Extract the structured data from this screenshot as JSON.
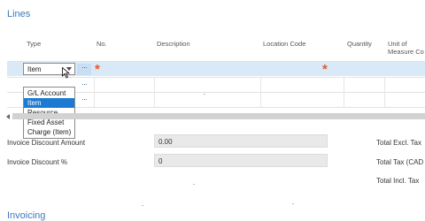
{
  "lines": {
    "heading": "Lines",
    "columns": {
      "type": "Type",
      "no": "No.",
      "description": "Description",
      "location_code": "Location Code",
      "quantity": "Quantity",
      "unit_of_measure": [
        "Unit of",
        "Measure Co"
      ]
    },
    "current_row": {
      "type_value": "Item",
      "lookup_label": "···",
      "required_marker": "*"
    },
    "type_dropdown": {
      "options": [
        "G/L Account",
        "Item",
        "Resource",
        "Fixed Asset",
        "Charge (Item)"
      ],
      "selected": "Item"
    }
  },
  "totals": {
    "invoice_discount_amount_label": "Invoice Discount Amount",
    "invoice_discount_amount_value": "0.00",
    "invoice_discount_pct_label": "Invoice Discount %",
    "invoice_discount_pct_value": "0",
    "total_excl_tax_label": "Total Excl. Tax",
    "total_tax_label": "Total Tax (CAD",
    "total_incl_tax_label": "Total Incl. Tax"
  },
  "invoicing": {
    "heading": "Invoicing"
  },
  "colors": {
    "accent": "#3b7bbf",
    "selected_row": "#d9e9f7",
    "required_marker": "#e25a2b",
    "dropdown_selected": "#1c7ad2"
  }
}
